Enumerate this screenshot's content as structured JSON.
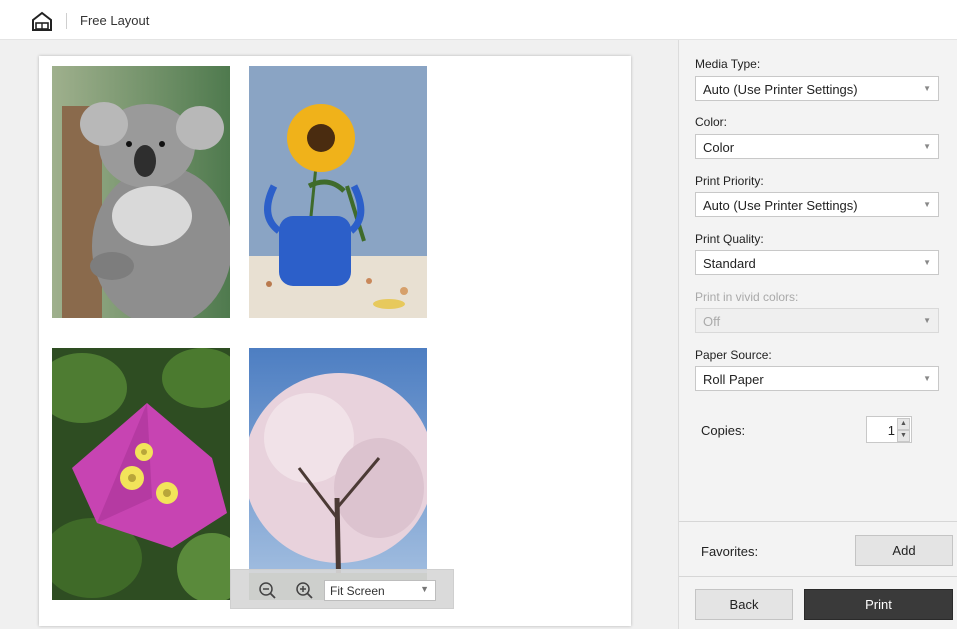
{
  "header": {
    "title": "Free Layout",
    "home_icon": "home-icon"
  },
  "preview": {
    "photos": [
      "koala",
      "sunflower-in-blue-vase",
      "bougainvillea-flower",
      "cherry-blossom-tree"
    ],
    "zoom": {
      "zoom_out_icon": "zoom-out-icon",
      "zoom_in_icon": "zoom-in-icon",
      "selected": "Fit Screen"
    }
  },
  "settings": {
    "media_type": {
      "label": "Media Type:",
      "value": "Auto (Use Printer Settings)"
    },
    "color": {
      "label": "Color:",
      "value": "Color"
    },
    "print_priority": {
      "label": "Print Priority:",
      "value": "Auto (Use Printer Settings)"
    },
    "print_quality": {
      "label": "Print Quality:",
      "value": "Standard"
    },
    "vivid_colors": {
      "label": "Print in vivid colors:",
      "value": "Off"
    },
    "paper_source": {
      "label": "Paper Source:",
      "value": "Roll Paper"
    },
    "copies": {
      "label": "Copies:",
      "value": "1"
    }
  },
  "favorites": {
    "label": "Favorites:",
    "add_label": "Add"
  },
  "footer": {
    "back_label": "Back",
    "print_label": "Print"
  },
  "colors": {
    "print_button": "#3a3a3a",
    "panel_bg": "#f3f3f3"
  }
}
